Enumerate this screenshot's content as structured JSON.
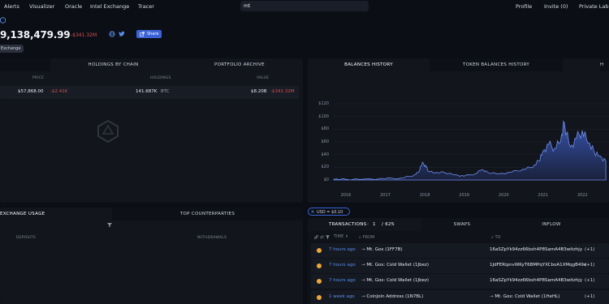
{
  "nav": {
    "left": [
      "Alerts",
      "Visualizer",
      "Oracle",
      "Intel Exchange",
      "Tracer"
    ],
    "search_value": "mt",
    "right": [
      "Profile",
      "Invite (0)",
      "Private Lab"
    ]
  },
  "header": {
    "balance": "9,138,479.99",
    "change": "-$341.32M",
    "share_label": "Share",
    "tag": "Exchange"
  },
  "holdings": {
    "tabs": [
      "HOLDINGS BY CHAIN",
      "PORTFOLIO ARCHIVE"
    ],
    "columns": [
      "PRICE",
      "HOLDINGS",
      "VALUE"
    ],
    "row": {
      "price": "$57,868.00",
      "price_change": "-$2.41K",
      "holdings": "141.687K",
      "holdings_unit": "BTC",
      "value": "$8.20B",
      "value_change": "-$341.32M"
    }
  },
  "usage": {
    "tabs": [
      "EXCHANGE USAGE",
      "TOP COUNTERPARTIES"
    ],
    "deposits_label": "DEPOSITS",
    "withdrawals_label": "WITHDRAWALS"
  },
  "chart_panel": {
    "tabs": [
      "BALANCES HISTORY",
      "TOKEN BALANCES HISTORY",
      "H"
    ]
  },
  "chart_data": {
    "type": "area",
    "title": "",
    "xlabel": "",
    "ylabel": "",
    "x_ticks": [
      "2016",
      "2017",
      "2018",
      "2019",
      "2020",
      "2021",
      "2022"
    ],
    "y_ticks": [
      "$0",
      "$20",
      "$40",
      "$60",
      "$80",
      "$100",
      "$120"
    ],
    "ylim": [
      0,
      120
    ],
    "x": [
      2015.7,
      2016.0,
      2016.5,
      2017.0,
      2017.4,
      2017.7,
      2017.85,
      2017.95,
      2018.05,
      2018.1,
      2018.25,
      2018.5,
      2018.8,
      2019.0,
      2019.3,
      2019.45,
      2019.6,
      2019.9,
      2020.2,
      2020.5,
      2020.75,
      2020.9,
      2021.0,
      2021.15,
      2021.3,
      2021.45,
      2021.55,
      2021.7,
      2021.85,
      2022.0,
      2022.15,
      2022.3,
      2022.45,
      2022.6
    ],
    "values": [
      1,
      1,
      1.5,
      2,
      3,
      6,
      12,
      28,
      20,
      14,
      11,
      12,
      8,
      6,
      10,
      16,
      12,
      10,
      12,
      17,
      20,
      30,
      45,
      56,
      50,
      60,
      90,
      52,
      65,
      78,
      58,
      45,
      38,
      30
    ],
    "grid": true
  },
  "usd_badge": "USD = $0.10",
  "tx_panel": {
    "tabs": [
      "TRANSACTIONS",
      "SWAPS",
      "INFLOW"
    ],
    "page_current": "1",
    "page_total": "/ 625",
    "columns": [
      "TIME",
      "FROM",
      "TO"
    ],
    "rows": [
      {
        "time": "7 hours ago",
        "from": "Mt. Gox (1FF7B)",
        "to": "16aSZpYk94zz66bxh4P8SamA4B3witzhjy",
        "more": "(+1)"
      },
      {
        "time": "7 hours ago",
        "from": "Mt. Gox: Cold Wallet (1Jbez)",
        "to": "1JdFERipnvWKyT6BMPqYXCboA1XMqgB49e",
        "more": "(+1)"
      },
      {
        "time": "7 hours ago",
        "from": "Mt. Gox: Cold Wallet (1Jbez)",
        "to": "16aSZpYk94zz66bxh4P8SamA4B3witzhjy",
        "more": "(+1)"
      },
      {
        "time": "1 week ago",
        "from": "CoinJoin Address (1N7BL)",
        "to": "Mt. Gox: Cold Wallet (1HeHL)",
        "more": "(+1)"
      }
    ]
  }
}
